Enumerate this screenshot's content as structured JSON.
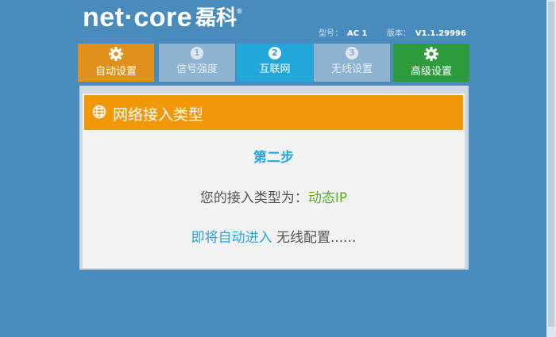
{
  "header": {
    "brand": "net·core",
    "brand_cn": "磊科",
    "reg_mark": "®",
    "model_label": "型号：",
    "model_value": "AC 1",
    "version_label": "版本：",
    "version_value": "V1.1.29996"
  },
  "steps": {
    "auto": {
      "label": "自动设置",
      "icon": "gear-icon"
    },
    "s1": {
      "num": "1",
      "label": "信号强度"
    },
    "s2": {
      "num": "2",
      "label": "互联网"
    },
    "s3": {
      "num": "3",
      "label": "无线设置"
    },
    "advanced": {
      "label": "高级设置",
      "icon": "gear-icon"
    }
  },
  "dialog": {
    "title": "网络接入类型",
    "step_title": "第二步",
    "type_prefix": "您的接入类型为：",
    "type_value": "动态IP",
    "next_highlight": "即将自动进入",
    "next_rest": " 无线配置......"
  },
  "colors": {
    "background": "#4a8bbd",
    "orange": "#f0980a",
    "active_blue": "#21a8d9",
    "green": "#2e9b3c"
  }
}
